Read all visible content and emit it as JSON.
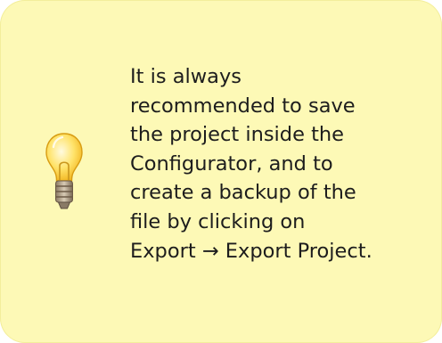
{
  "tip": {
    "icon": "lightbulb-icon",
    "text": "It is always\nrecommended to save\nthe project inside the\nConfigurator, and to\ncreate a backup of the\nfile by clicking on\nExport → Export Project."
  },
  "colors": {
    "background": "#fdf9b6",
    "text": "#1d1d1d"
  }
}
